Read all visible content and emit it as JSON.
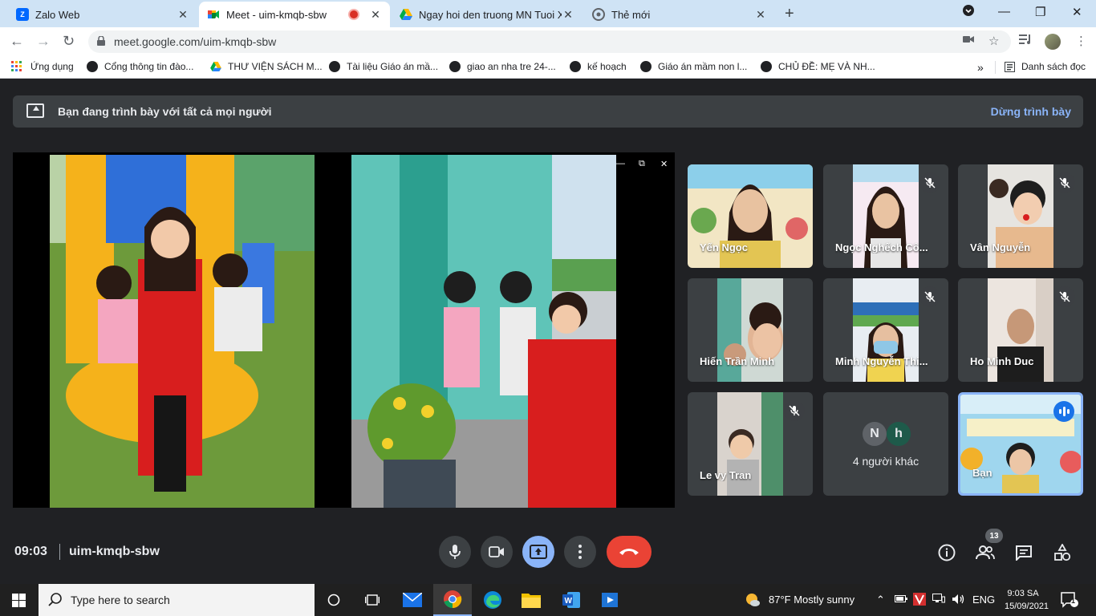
{
  "browser": {
    "tabs": [
      {
        "title": "Zalo Web",
        "active": false
      },
      {
        "title": "Meet - uim-kmqb-sbw",
        "active": true
      },
      {
        "title": "Ngay hoi den truong MN Tuoi Xanh",
        "active": false
      },
      {
        "title": "Thẻ mới",
        "active": false
      }
    ],
    "url": "meet.google.com/uim-kmqb-sbw",
    "bookmarks": [
      {
        "label": "Ứng dụng"
      },
      {
        "label": "Cổng thông tin đào..."
      },
      {
        "label": "THƯ VIỆN SÁCH M..."
      },
      {
        "label": "Tài liệu Giáo án mầ..."
      },
      {
        "label": "giao an nha tre 24-..."
      },
      {
        "label": "kế hoạch"
      },
      {
        "label": "Giáo án mầm non l..."
      },
      {
        "label": "CHỦ ĐỀ: MẸ VÀ NH..."
      }
    ],
    "reading_list": "Danh sách đọc",
    "more_bookmarks": "»"
  },
  "meet": {
    "banner": {
      "text": "Bạn đang trình bày với tất cả mọi người",
      "stop": "Dừng trình bày"
    },
    "participants": [
      {
        "name": "Yến Ngọc",
        "muted": false,
        "wide": true
      },
      {
        "name": "Ngọc Nghếch Cô...",
        "muted": true,
        "wide": false
      },
      {
        "name": "Vân Nguyễn",
        "muted": true,
        "wide": false
      },
      {
        "name": "Hiến Trần Minh",
        "muted": false,
        "wide": false
      },
      {
        "name": "Minh Nguyễn Thi...",
        "muted": true,
        "wide": false
      },
      {
        "name": "Ho Minh Duc",
        "muted": true,
        "wide": false
      },
      {
        "name": "Le vy Tran",
        "muted": true,
        "wide": false
      }
    ],
    "others": {
      "initials": [
        "N",
        "h"
      ],
      "label": "4 người khác"
    },
    "self": {
      "name": "Bạn"
    },
    "time": "09:03",
    "meeting_code": "uim-kmqb-sbw",
    "participant_count": "13",
    "colors": {
      "present": "#8ab4f8",
      "leave": "#ea4335",
      "banner": "#3c4043"
    }
  },
  "taskbar": {
    "search_placeholder": "Type here to search",
    "weather": "87°F  Mostly sunny",
    "language": "ENG",
    "time": "9:03 SA",
    "date": "15/09/2021",
    "notifications": "1"
  }
}
